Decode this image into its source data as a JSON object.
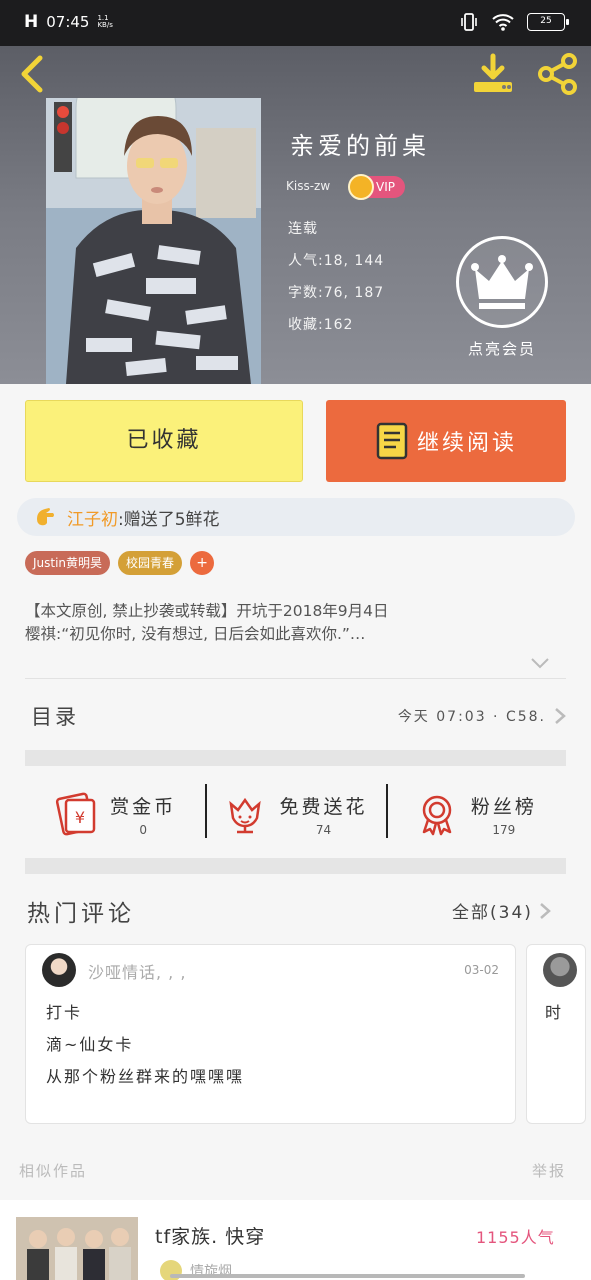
{
  "status_bar": {
    "time": "07:45",
    "net_speed": "1.1 KB/s",
    "signal": "H",
    "battery": "25"
  },
  "book": {
    "title": "亲爱的前桌",
    "author": "Kiss-zw",
    "vip_label": "VIP",
    "status": "连载",
    "popularity": "人气:18, 144",
    "word_count": "字数:76, 187",
    "favorites": "收藏:162"
  },
  "member": {
    "label": "点亮会员"
  },
  "actions": {
    "collect_label": "已收藏",
    "read_label": "继续阅读"
  },
  "gift": {
    "giver": "江子初",
    "text": ":赠送了5鲜花"
  },
  "tags": [
    "Justin黄明昊",
    "校园青春"
  ],
  "tag_add": "+",
  "synopsis": {
    "line1": "【本文原创, 禁止抄袭或转载】开坑于2018年9月4日",
    "line2": "樱祺:“初见你时, 没有想过, 日后会如此喜欢你.”…"
  },
  "catalog": {
    "label": "目录",
    "latest": "今天 07:03 · C58."
  },
  "stats": [
    {
      "name": "赏金币",
      "value": "0",
      "icon": "red-envelope-icon"
    },
    {
      "name": "免费送花",
      "value": "74",
      "icon": "flower-icon"
    },
    {
      "name": "粉丝榜",
      "value": "179",
      "icon": "medal-icon"
    }
  ],
  "comments": {
    "title": "热门评论",
    "all_label": "全部(34)",
    "items": [
      {
        "user": "沙哑情话, , ,",
        "date": "03-02",
        "lines": [
          "打卡",
          "滴~仙女卡",
          "从那个粉丝群来的嘿嘿嘿"
        ]
      },
      {
        "preview": "时"
      }
    ]
  },
  "similar": {
    "label": "相似作品",
    "report_label": "举报",
    "item": {
      "title": "tf家族. 快穿",
      "popularity": "1155人气",
      "author": "情旋烟"
    }
  },
  "colors": {
    "accent_orange": "#ec6a3e",
    "collect_yellow": "#fbf17a",
    "vip_pink": "#e4557d",
    "gift_orange": "#f19a27"
  }
}
